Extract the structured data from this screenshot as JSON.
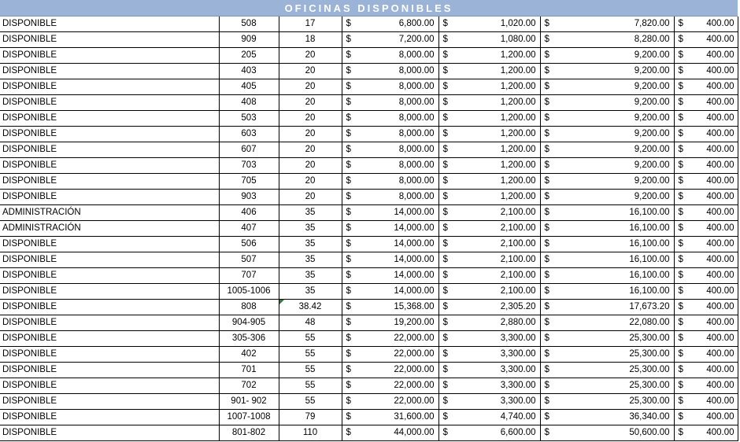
{
  "title": "OFICINAS DISPONIBLES",
  "currency_symbol": "$",
  "rows": [
    {
      "status": "DISPONIBLE",
      "office": "508",
      "m2": "17",
      "rent": "6,800.00",
      "maint": "1,020.00",
      "total": "7,820.00",
      "parking": "400.00"
    },
    {
      "status": "DISPONIBLE",
      "office": "909",
      "m2": "18",
      "rent": "7,200.00",
      "maint": "1,080.00",
      "total": "8,280.00",
      "parking": "400.00"
    },
    {
      "status": "DISPONIBLE",
      "office": "205",
      "m2": "20",
      "rent": "8,000.00",
      "maint": "1,200.00",
      "total": "9,200.00",
      "parking": "400.00"
    },
    {
      "status": "DISPONIBLE",
      "office": "403",
      "m2": "20",
      "rent": "8,000.00",
      "maint": "1,200.00",
      "total": "9,200.00",
      "parking": "400.00"
    },
    {
      "status": "DISPONIBLE",
      "office": "405",
      "m2": "20",
      "rent": "8,000.00",
      "maint": "1,200.00",
      "total": "9,200.00",
      "parking": "400.00"
    },
    {
      "status": "DISPONIBLE",
      "office": "408",
      "m2": "20",
      "rent": "8,000.00",
      "maint": "1,200.00",
      "total": "9,200.00",
      "parking": "400.00"
    },
    {
      "status": "DISPONIBLE",
      "office": "503",
      "m2": "20",
      "rent": "8,000.00",
      "maint": "1,200.00",
      "total": "9,200.00",
      "parking": "400.00"
    },
    {
      "status": "DISPONIBLE",
      "office": "603",
      "m2": "20",
      "rent": "8,000.00",
      "maint": "1,200.00",
      "total": "9,200.00",
      "parking": "400.00"
    },
    {
      "status": "DISPONIBLE",
      "office": "607",
      "m2": "20",
      "rent": "8,000.00",
      "maint": "1,200.00",
      "total": "9,200.00",
      "parking": "400.00"
    },
    {
      "status": "DISPONIBLE",
      "office": "703",
      "m2": "20",
      "rent": "8,000.00",
      "maint": "1,200.00",
      "total": "9,200.00",
      "parking": "400.00"
    },
    {
      "status": "DISPONIBLE",
      "office": "705",
      "m2": "20",
      "rent": "8,000.00",
      "maint": "1,200.00",
      "total": "9,200.00",
      "parking": "400.00"
    },
    {
      "status": "DISPONIBLE",
      "office": "903",
      "m2": "20",
      "rent": "8,000.00",
      "maint": "1,200.00",
      "total": "9,200.00",
      "parking": "400.00"
    },
    {
      "status": "ADMINISTRACIÓN",
      "office": "406",
      "m2": "35",
      "rent": "14,000.00",
      "maint": "2,100.00",
      "total": "16,100.00",
      "parking": "400.00"
    },
    {
      "status": "ADMINISTRACIÓN",
      "office": "407",
      "m2": "35",
      "rent": "14,000.00",
      "maint": "2,100.00",
      "total": "16,100.00",
      "parking": "400.00"
    },
    {
      "status": "DISPONIBLE",
      "office": "506",
      "m2": "35",
      "rent": "14,000.00",
      "maint": "2,100.00",
      "total": "16,100.00",
      "parking": "400.00"
    },
    {
      "status": "DISPONIBLE",
      "office": "507",
      "m2": "35",
      "rent": "14,000.00",
      "maint": "2,100.00",
      "total": "16,100.00",
      "parking": "400.00"
    },
    {
      "status": "DISPONIBLE",
      "office": "707",
      "m2": "35",
      "rent": "14,000.00",
      "maint": "2,100.00",
      "total": "16,100.00",
      "parking": "400.00"
    },
    {
      "status": "DISPONIBLE",
      "office": "1005-1006",
      "m2": "35",
      "rent": "14,000.00",
      "maint": "2,100.00",
      "total": "16,100.00",
      "parking": "400.00"
    },
    {
      "status": "DISPONIBLE",
      "office": "808",
      "m2": "38.42",
      "rent": "15,368.00",
      "maint": "2,305.20",
      "total": "17,673.20",
      "parking": "400.00",
      "flag": true
    },
    {
      "status": "DISPONIBLE",
      "office": "904-905",
      "m2": "48",
      "rent": "19,200.00",
      "maint": "2,880.00",
      "total": "22,080.00",
      "parking": "400.00"
    },
    {
      "status": "DISPONIBLE",
      "office": "305-306",
      "m2": "55",
      "rent": "22,000.00",
      "maint": "3,300.00",
      "total": "25,300.00",
      "parking": "400.00"
    },
    {
      "status": "DISPONIBLE",
      "office": "402",
      "m2": "55",
      "rent": "22,000.00",
      "maint": "3,300.00",
      "total": "25,300.00",
      "parking": "400.00"
    },
    {
      "status": "DISPONIBLE",
      "office": "701",
      "m2": "55",
      "rent": "22,000.00",
      "maint": "3,300.00",
      "total": "25,300.00",
      "parking": "400.00"
    },
    {
      "status": "DISPONIBLE",
      "office": "702",
      "m2": "55",
      "rent": "22,000.00",
      "maint": "3,300.00",
      "total": "25,300.00",
      "parking": "400.00"
    },
    {
      "status": "DISPONIBLE",
      "office": "901- 902",
      "m2": "55",
      "rent": "22,000.00",
      "maint": "3,300.00",
      "total": "25,300.00",
      "parking": "400.00"
    },
    {
      "status": "DISPONIBLE",
      "office": "1007-1008",
      "m2": "79",
      "rent": "31,600.00",
      "maint": "4,740.00",
      "total": "36,340.00",
      "parking": "400.00"
    },
    {
      "status": "DISPONIBLE",
      "office": "801-802",
      "m2": "110",
      "rent": "44,000.00",
      "maint": "6,600.00",
      "total": "50,600.00",
      "parking": "400.00"
    }
  ]
}
